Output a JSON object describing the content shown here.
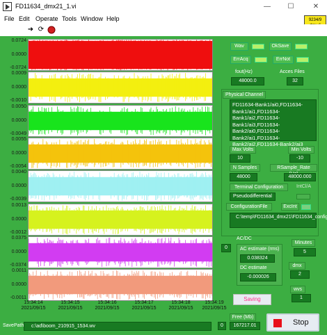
{
  "window": {
    "title": "FD11634_dmx21_1.vi",
    "minimize": "—",
    "maximize": "☐",
    "close": "✕",
    "badge": "9234/9 dmx 6"
  },
  "menu": [
    "File",
    "Edit",
    "Operate",
    "Tools",
    "Window",
    "Help"
  ],
  "toolbar": {
    "run_icon": "run-arrow-icon",
    "run_continuous_icon": "run-continuous-icon",
    "abort_icon": "abort-icon"
  },
  "charts": [
    {
      "ymax": "0.0724",
      "ymid": "0.0000",
      "ymin": "-0.0724",
      "color": "#ef0e0e",
      "fill": 0.92
    },
    {
      "ymax": "0.0009",
      "ymid": "0.0000",
      "ymin": "-0.0010",
      "color": "#f3ef0f",
      "fill": 0.6
    },
    {
      "ymax": "0.0050",
      "ymid": "0.0000",
      "ymin": "-0.0049",
      "color": "#18e41c",
      "fill": 0.6
    },
    {
      "ymax": "0.0055",
      "ymid": "0.0000",
      "ymin": "-0.0054",
      "color": "#f4c30c",
      "fill": 0.6
    },
    {
      "ymax": "0.0040",
      "ymid": "0.0000",
      "ymin": "-0.0039",
      "color": "#9ff0f2",
      "fill": 0.6
    },
    {
      "ymax": "0.0013",
      "ymid": "0.0000",
      "ymin": "-0.0012",
      "color": "#d6f21e",
      "fill": 0.6
    },
    {
      "ymax": "0.0375",
      "ymid": "0.0000",
      "ymin": "-0.0374",
      "color": "#d23cf2",
      "fill": 0.6
    },
    {
      "ymax": "0.0011",
      "ymid": "0.0000",
      "ymin": "-0.0011",
      "color": "#f29a7c",
      "fill": 0.6
    }
  ],
  "x_axis": [
    {
      "time": "15:34:14",
      "date": "2021/09/15"
    },
    {
      "time": "15:34:15",
      "date": "2021/09/15"
    },
    {
      "time": "15:34:16",
      "date": "2021/09/15"
    },
    {
      "time": "15:34:17",
      "date": "2021/09/15"
    },
    {
      "time": "15:34:18",
      "date": "2021/09/15"
    },
    {
      "time": "15:34:19",
      "date": "2021/09/15"
    }
  ],
  "leds": {
    "wav": "Wav",
    "oksave": "OkSave",
    "erracq": "ErrAcq",
    "errnot": "ErrNot",
    "on_color": "#b7f06a"
  },
  "fout": {
    "label": "fout(Hz)",
    "value": "48000.0"
  },
  "acces_files": {
    "label": "Acces Files",
    "value": "32"
  },
  "physical_channel": {
    "label": "Physical Channel",
    "value": "FD11634-Bank1/ai0,FD11634-Bank1/ai1,FD11634-Bank1/ai2,FD11634-Bank1/ai3,FD11634-Bank2/ai0,FD11634-Bank2/ai1,FD11634-Bank2/ai2,FD11634-Bank2/ai3"
  },
  "max_volts": {
    "label": "Max Volts",
    "value": "10"
  },
  "min_volts": {
    "label": "Min Volts",
    "value": "-10"
  },
  "n_samples": {
    "label": "N Samples",
    "value": "48000"
  },
  "rsample_rate": {
    "label": "RSample_Rate (Hz)",
    "value": "48000.000"
  },
  "terminal_config": {
    "label": "Terminal Configuration",
    "value": "Pseudodifferential",
    "intclk": "IntCl/A"
  },
  "config_file": {
    "label": "ConfigurationFile",
    "excint": "ExcInt",
    "value": "C:\\temp\\FD11634_dmx21\\FD11634_config.inp"
  },
  "acdc": {
    "label": "AC/DC",
    "index": "0",
    "ac_label": "AC estimate (rms)",
    "ac_value": "0.038324",
    "dc_label": "DC estimate",
    "dc_value": "-0.000026"
  },
  "minutes": {
    "label": "Minutes",
    "value": "5"
  },
  "dmx": {
    "label": "dmx",
    "value": "2"
  },
  "wvs": {
    "label": "wvs",
    "value": "1"
  },
  "saving": "Saving",
  "free": {
    "label": "Free (Mb)",
    "value": "167217.01",
    "index": "0"
  },
  "savepath": {
    "label": "SavePath",
    "value": "c:\\ad\\boom_210915_1534.wv"
  },
  "stop": "Stop"
}
